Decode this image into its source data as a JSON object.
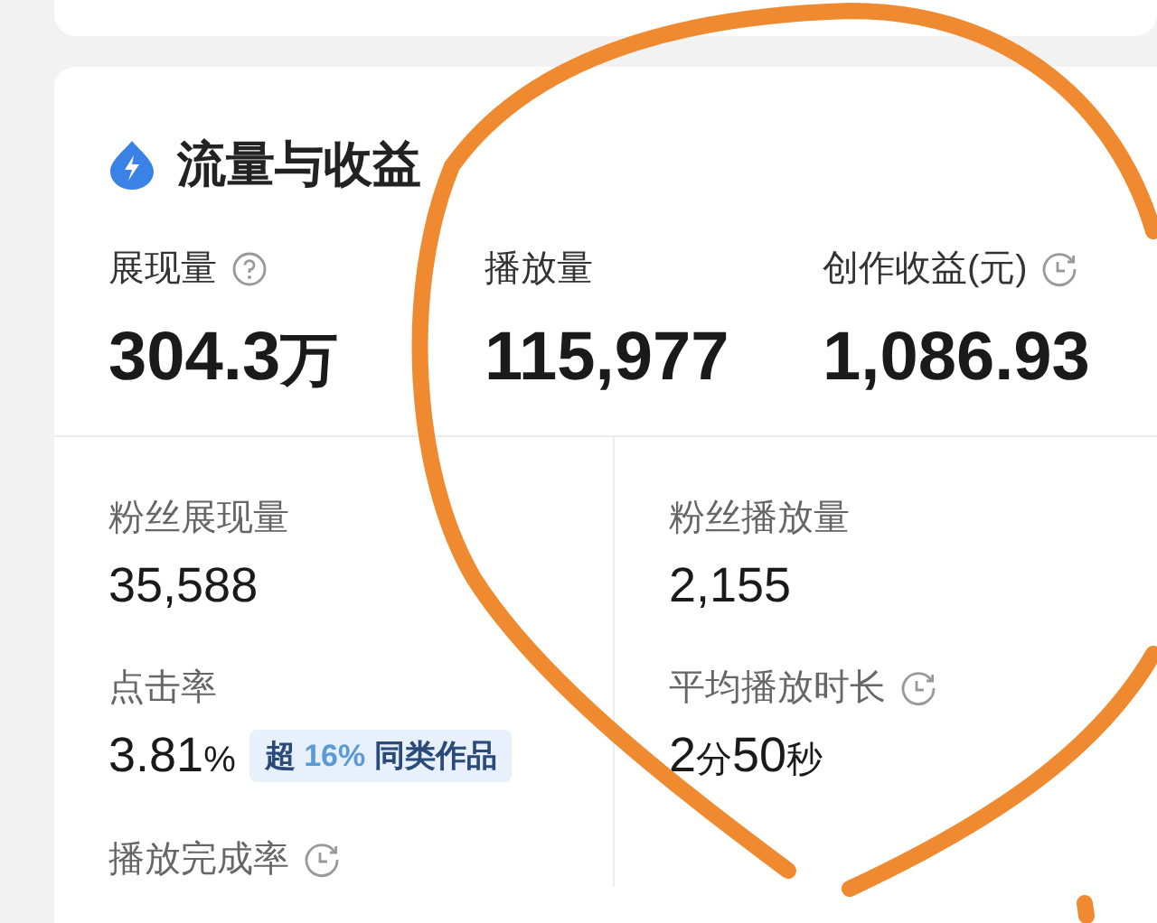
{
  "section": {
    "title": "流量与收益"
  },
  "top_metrics": [
    {
      "label": "展现量",
      "kind": "help",
      "value": "304.3万"
    },
    {
      "label": "播放量",
      "kind": "plain",
      "value": "115,977"
    },
    {
      "label": "创作收益(元)",
      "kind": "clock",
      "value": "1,086.93"
    }
  ],
  "left_metrics": [
    {
      "label": "粉丝展现量",
      "kind": "plain",
      "value": "35,588"
    },
    {
      "label": "点击率",
      "kind": "plain",
      "value": "3.81%",
      "badge": {
        "lead": "超",
        "percent": "16%",
        "tail": "同类作品"
      }
    },
    {
      "label": "播放完成率",
      "kind": "clock"
    }
  ],
  "right_metrics": [
    {
      "label": "粉丝播放量",
      "kind": "plain",
      "value": "2,155"
    },
    {
      "label": "平均播放时长",
      "kind": "clock",
      "value": "2分50秒"
    }
  ]
}
